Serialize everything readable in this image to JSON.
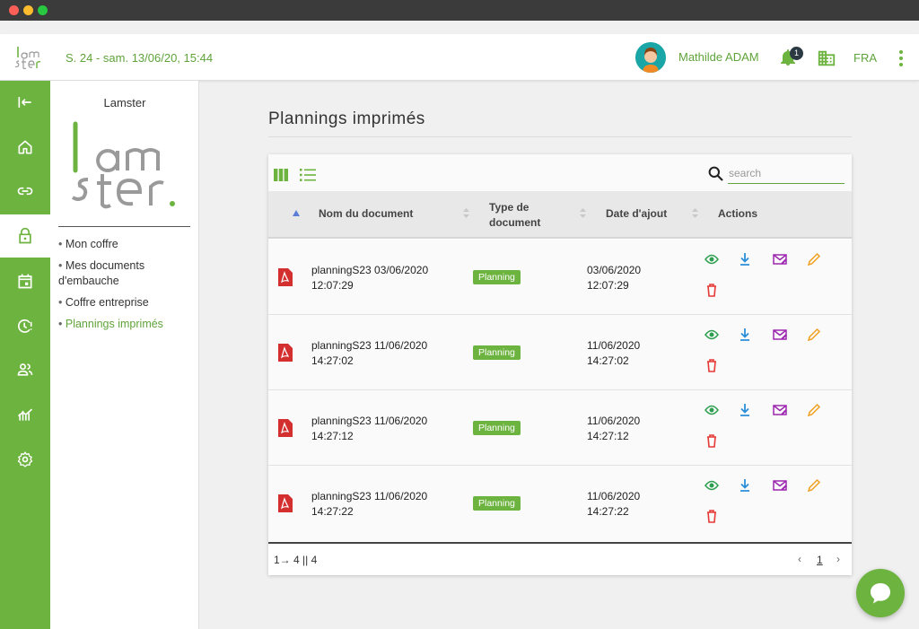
{
  "header": {
    "date": "S. 24 - sam. 13/06/20, 15:44",
    "user_name": "Mathilde ADAM",
    "notification_count": "1",
    "language": "FRA"
  },
  "subnav": {
    "title": "Lamster",
    "items": [
      {
        "label": "Mon coffre",
        "active": false
      },
      {
        "label": "Mes documents d'embauche",
        "active": false
      },
      {
        "label": "Coffre entreprise",
        "active": false
      },
      {
        "label": "Plannings imprimés",
        "active": true
      }
    ]
  },
  "rail": {
    "items": [
      "collapse-icon",
      "home-icon",
      "link-icon",
      "lock-icon",
      "calendar-icon",
      "clock-alert-icon",
      "people-icon",
      "chart-icon",
      "gear-icon"
    ],
    "active": "lock-icon"
  },
  "main": {
    "title": "Plannings imprimés",
    "search_placeholder": "search",
    "columns": {
      "name": "Nom du document",
      "type_line1": "Type de",
      "type_line2": "document",
      "date": "Date d'ajout",
      "actions": "Actions"
    },
    "rows": [
      {
        "name_line1": "planningS23 03/06/2020",
        "name_line2": "12:07:29",
        "type": "Planning",
        "date_line1": "03/06/2020",
        "date_line2": "12:07:29"
      },
      {
        "name_line1": "planningS23 11/06/2020",
        "name_line2": "14:27:02",
        "type": "Planning",
        "date_line1": "11/06/2020",
        "date_line2": "14:27:02"
      },
      {
        "name_line1": "planningS23 11/06/2020",
        "name_line2": "14:27:12",
        "type": "Planning",
        "date_line1": "11/06/2020",
        "date_line2": "14:27:12"
      },
      {
        "name_line1": "planningS23 11/06/2020",
        "name_line2": "14:27:22",
        "type": "Planning",
        "date_line1": "11/06/2020",
        "date_line2": "14:27:22"
      }
    ],
    "footer": {
      "range": "1→ 4 || 4",
      "prev": "‹",
      "page": "1",
      "next": "›"
    }
  },
  "colors": {
    "brand_green": "#6db33f",
    "text_green": "#5fa33a",
    "view": "#2e9e4f",
    "download": "#2b8fd8",
    "mail": "#9c27b0",
    "edit": "#f0a020",
    "delete": "#e53935",
    "pdf": "#d32f2f"
  }
}
